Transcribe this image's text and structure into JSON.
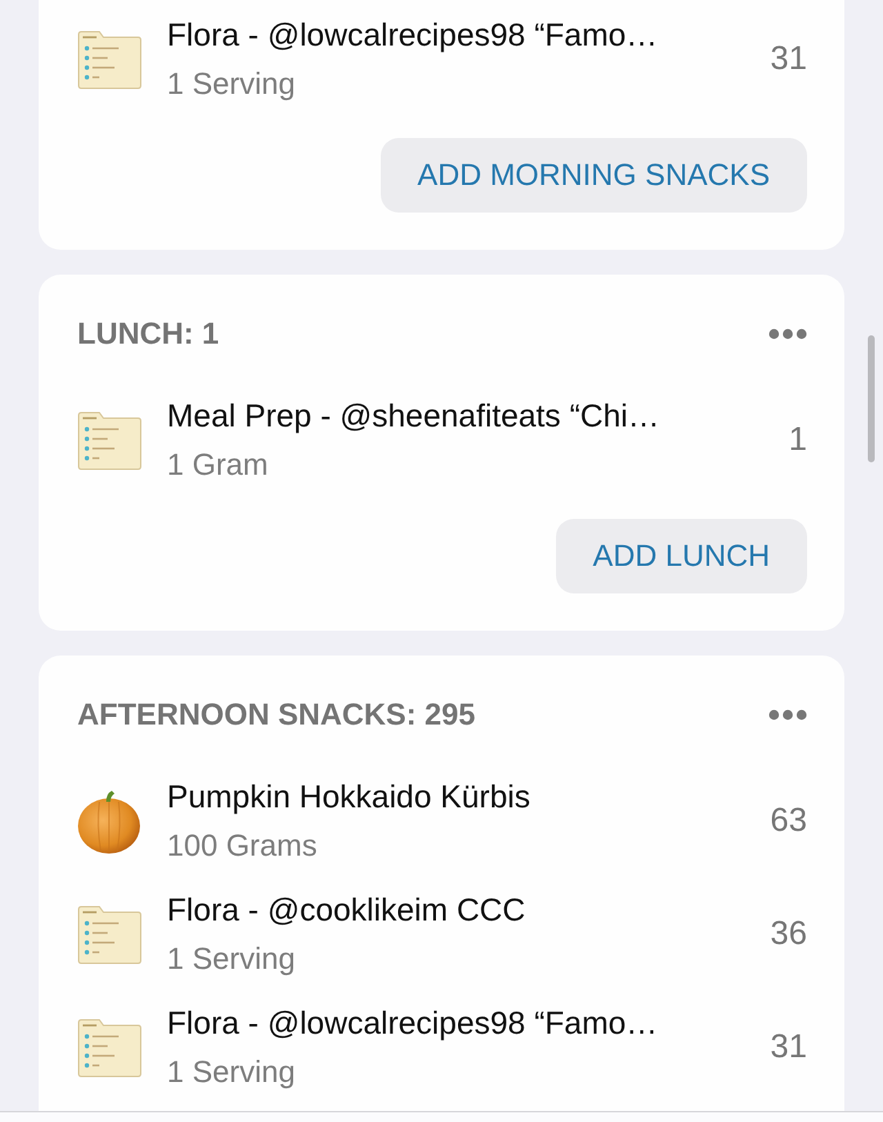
{
  "meals": [
    {
      "items": [
        {
          "kind": "recipe",
          "name": "Flora - @lowcalrecipes98 “Famo…",
          "amount": "1 Serving",
          "calories": "31"
        }
      ],
      "add_button": "ADD MORNING SNACKS"
    },
    {
      "title": "LUNCH: 1",
      "items": [
        {
          "kind": "recipe",
          "name": "Meal Prep - @sheenafiteats “Chi…",
          "amount": "1 Gram",
          "calories": "1"
        }
      ],
      "add_button": "ADD LUNCH"
    },
    {
      "title": "AFTERNOON SNACKS: 295",
      "items": [
        {
          "kind": "food",
          "name": "Pumpkin Hokkaido Kürbis",
          "amount": "100 Grams",
          "calories": "63"
        },
        {
          "kind": "recipe",
          "name": "Flora - @cooklikeim CCC",
          "amount": "1 Serving",
          "calories": "36"
        },
        {
          "kind": "recipe",
          "name": "Flora - @lowcalrecipes98 “Famo…",
          "amount": "1 Serving",
          "calories": "31"
        }
      ]
    }
  ]
}
